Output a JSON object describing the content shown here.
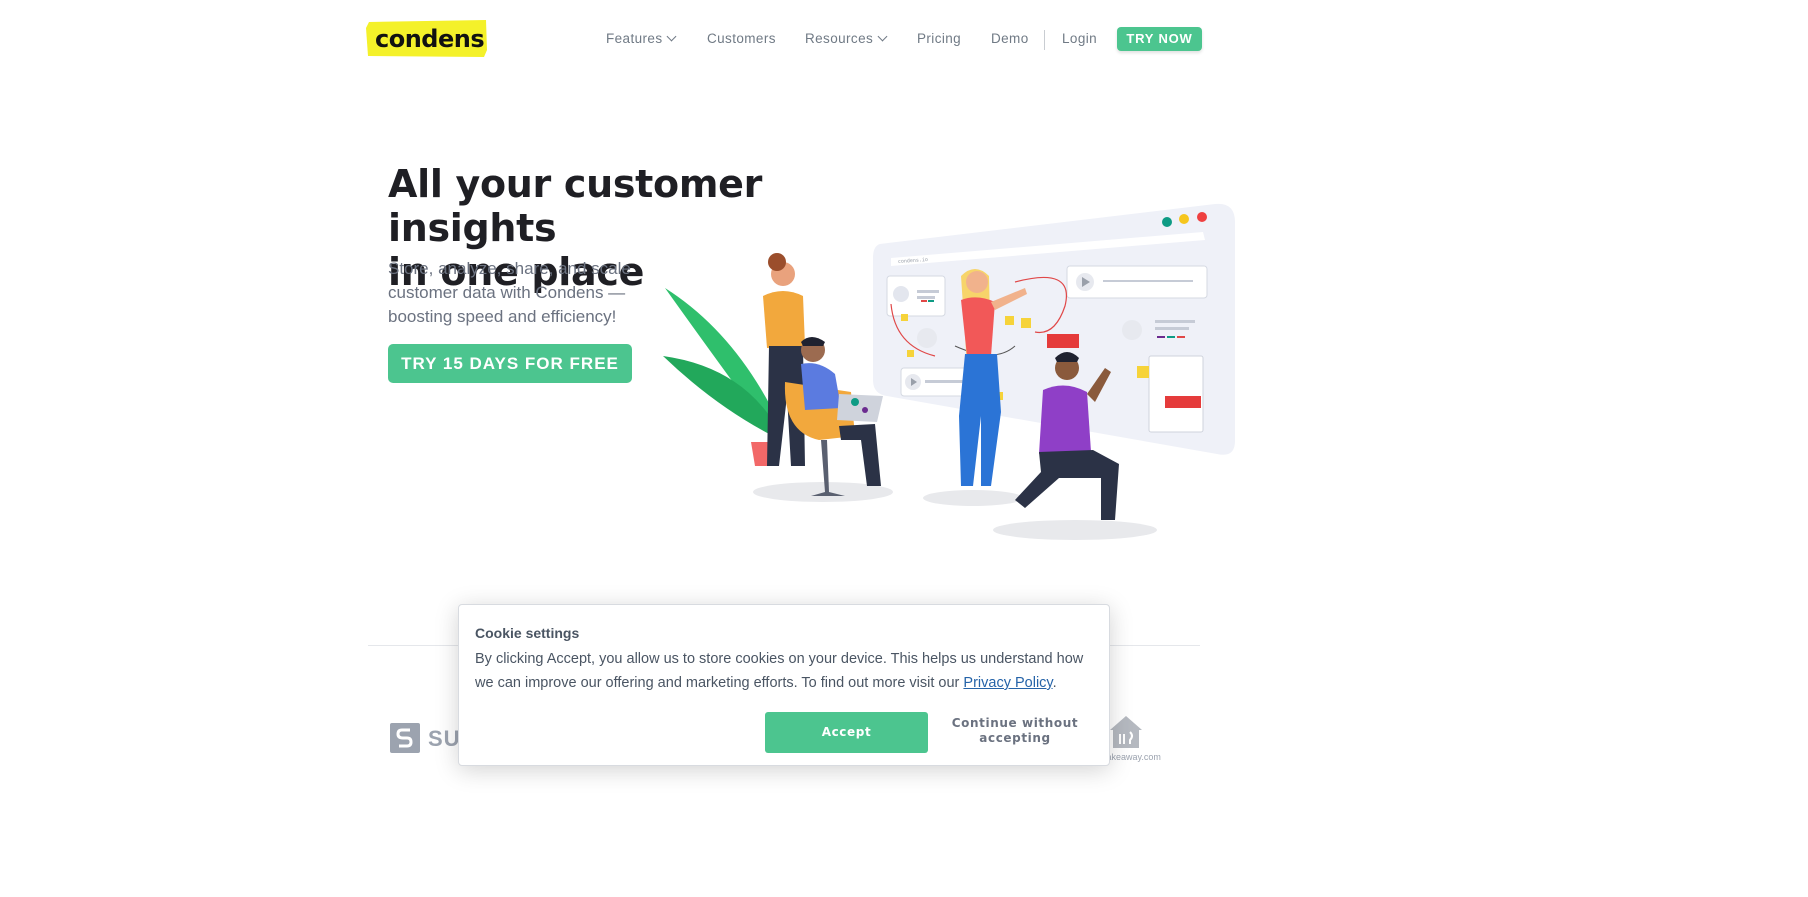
{
  "brand": {
    "logo_text": "condens",
    "logo_highlight": "#f4f12a",
    "accent": "#4cc58f"
  },
  "nav": {
    "items": [
      {
        "label": "Features",
        "has_dropdown": true
      },
      {
        "label": "Customers",
        "has_dropdown": false
      },
      {
        "label": "Resources",
        "has_dropdown": true
      },
      {
        "label": "Pricing",
        "has_dropdown": false
      },
      {
        "label": "Demo",
        "has_dropdown": false
      },
      {
        "label": "Login",
        "has_dropdown": false
      }
    ],
    "cta_label": "TRY NOW"
  },
  "hero": {
    "title_line1": "All your customer insights",
    "title_line2": "in one place",
    "subtitle": "Store, analyze, share, and scale customer data with Condens — boosting speed and efficiency!",
    "cta_label": "TRY 15 DAYS FOR FREE"
  },
  "illustration": {
    "url_bar_text": "condens.io",
    "icon": "team-collaboration-illustration"
  },
  "logos": {
    "left_partial_text": "SUN",
    "right_text": "Takeaway.com"
  },
  "cookie": {
    "title": "Cookie settings",
    "body_text": "By clicking Accept, you allow us to store cookies on your device. This helps us understand how we can improve our offering and marketing efforts. To find out more visit our ",
    "link_text": "Privacy Policy",
    "body_end": ".",
    "accept_label": "Accept",
    "continue_label": "Continue without accepting"
  }
}
